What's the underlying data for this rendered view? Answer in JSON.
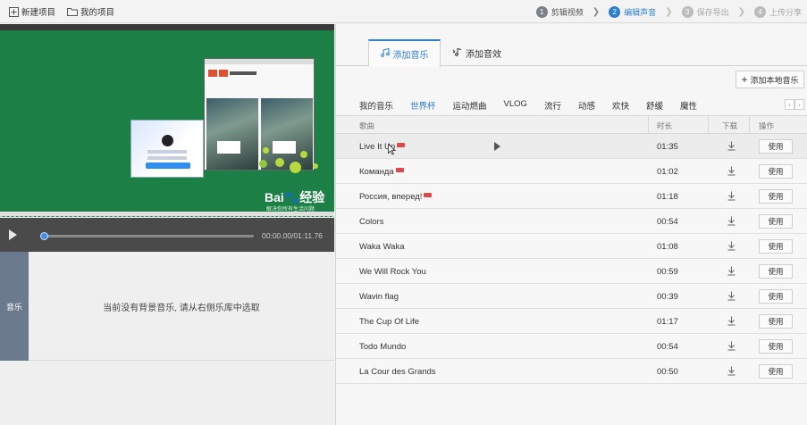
{
  "toolbar": {
    "new_project": "新建项目",
    "my_projects": "我的项目"
  },
  "steps": [
    {
      "num": "1",
      "label": "剪辑视频",
      "state": "done"
    },
    {
      "num": "2",
      "label": "编辑声音",
      "state": "active"
    },
    {
      "num": "3",
      "label": "保存导出",
      "state": "todo"
    },
    {
      "num": "4",
      "label": "上传分享",
      "state": "todo"
    }
  ],
  "video": {
    "logo_text": "Bai🐾经验",
    "logo_sub": "解决你所有生活问题"
  },
  "player": {
    "time": "00:00.00/01:11.76",
    "progress": 0.0
  },
  "track": {
    "label": "音乐",
    "empty_text": "当前没有背景音乐, 请从右侧乐库中选取"
  },
  "tabs": {
    "add_music": "添加音乐",
    "add_effect": "添加音效"
  },
  "add_local_label": "添加本地音乐",
  "categories": [
    "我的音乐",
    "世界杯",
    "运动燃曲",
    "VLOG",
    "流行",
    "动感",
    "欢快",
    "舒缓",
    "魔性"
  ],
  "active_category": "世界杯",
  "table": {
    "headers": {
      "song": "歌曲",
      "duration": "时长",
      "download": "下载",
      "action": "操作"
    },
    "use_label": "使用",
    "rows": [
      {
        "title": "Live It Up",
        "duration": "01:35",
        "hot": true
      },
      {
        "title": "Команда",
        "duration": "01:02",
        "hot": true
      },
      {
        "title": "Россия, вперед!",
        "duration": "01:18",
        "hot": true
      },
      {
        "title": "Colors",
        "duration": "00:54",
        "hot": false
      },
      {
        "title": "Waka Waka",
        "duration": "01:08",
        "hot": false
      },
      {
        "title": "We Will Rock You",
        "duration": "00:59",
        "hot": false
      },
      {
        "title": "Wavin flag",
        "duration": "00:39",
        "hot": false
      },
      {
        "title": "The Cup Of Life",
        "duration": "01:17",
        "hot": false
      },
      {
        "title": "Todo Mundo",
        "duration": "00:54",
        "hot": false
      },
      {
        "title": "La Cour des Grands",
        "duration": "00:50",
        "hot": false
      }
    ]
  },
  "colors": {
    "accent": "#2f7fcd",
    "video_bg": "#1c8046",
    "track_label": "#6c7a8e"
  }
}
